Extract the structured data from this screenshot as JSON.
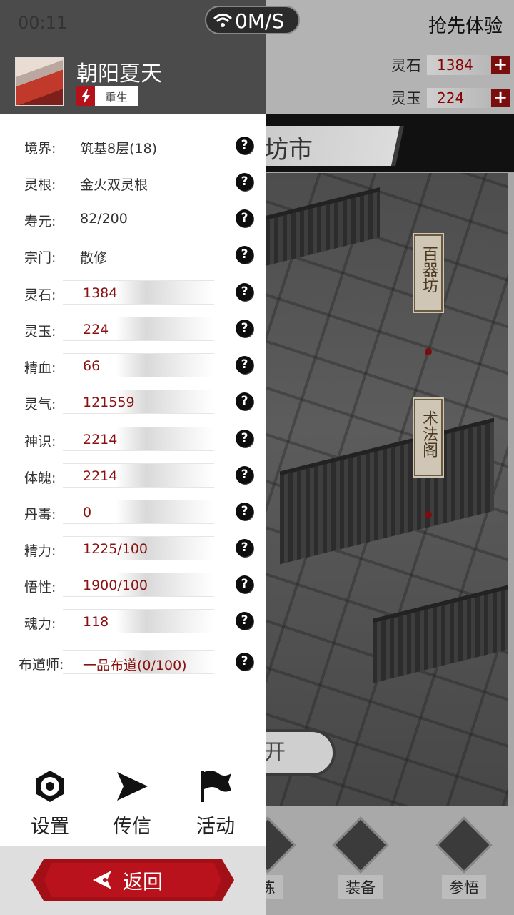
{
  "status": {
    "time": "00:11",
    "network": "0M/S"
  },
  "background": {
    "top_right_text": "抢先体验",
    "resources": [
      {
        "label": "灵石",
        "value": "1384"
      },
      {
        "label": "玉",
        "value": "224"
      }
    ],
    "banner_title": "坊市",
    "tags": [
      {
        "text": "百器坊"
      },
      {
        "text": "术法阁"
      }
    ],
    "partial_button_text": "开",
    "nav": [
      {
        "label": "练"
      },
      {
        "label": "装备"
      },
      {
        "label": "参悟"
      }
    ]
  },
  "player": {
    "name": "朝阳夏天",
    "badge": "重生"
  },
  "stats": [
    {
      "label": "境界:",
      "value": "筑基8层(18)",
      "bar": false
    },
    {
      "label": "灵根:",
      "value": "金火双灵根",
      "bar": false
    },
    {
      "label": "寿元:",
      "value": "82/200",
      "bar": false
    },
    {
      "label": "宗门:",
      "value": "散修",
      "bar": false
    },
    {
      "label": "灵石:",
      "value": "1384",
      "bar": true
    },
    {
      "label": "灵玉:",
      "value": "224",
      "bar": true
    },
    {
      "label": "精血:",
      "value": "66",
      "bar": true
    },
    {
      "label": "灵气:",
      "value": "121559",
      "bar": true
    },
    {
      "label": "神识:",
      "value": "2214",
      "bar": true
    },
    {
      "label": "体魄:",
      "value": "2214",
      "bar": true
    },
    {
      "label": "丹毒:",
      "value": "0",
      "bar": true
    },
    {
      "label": "精力:",
      "value": "1225/100",
      "bar": true
    },
    {
      "label": "悟性:",
      "value": "1900/100",
      "bar": true
    },
    {
      "label": "魂力:",
      "value": "118",
      "bar": true
    },
    {
      "label": "布道师:",
      "value": "一品布道(0/100)",
      "bar": true
    }
  ],
  "help_glyph": "?",
  "menu": {
    "settings": "设置",
    "message": "传信",
    "activity": "活动"
  },
  "back_label": "返回"
}
